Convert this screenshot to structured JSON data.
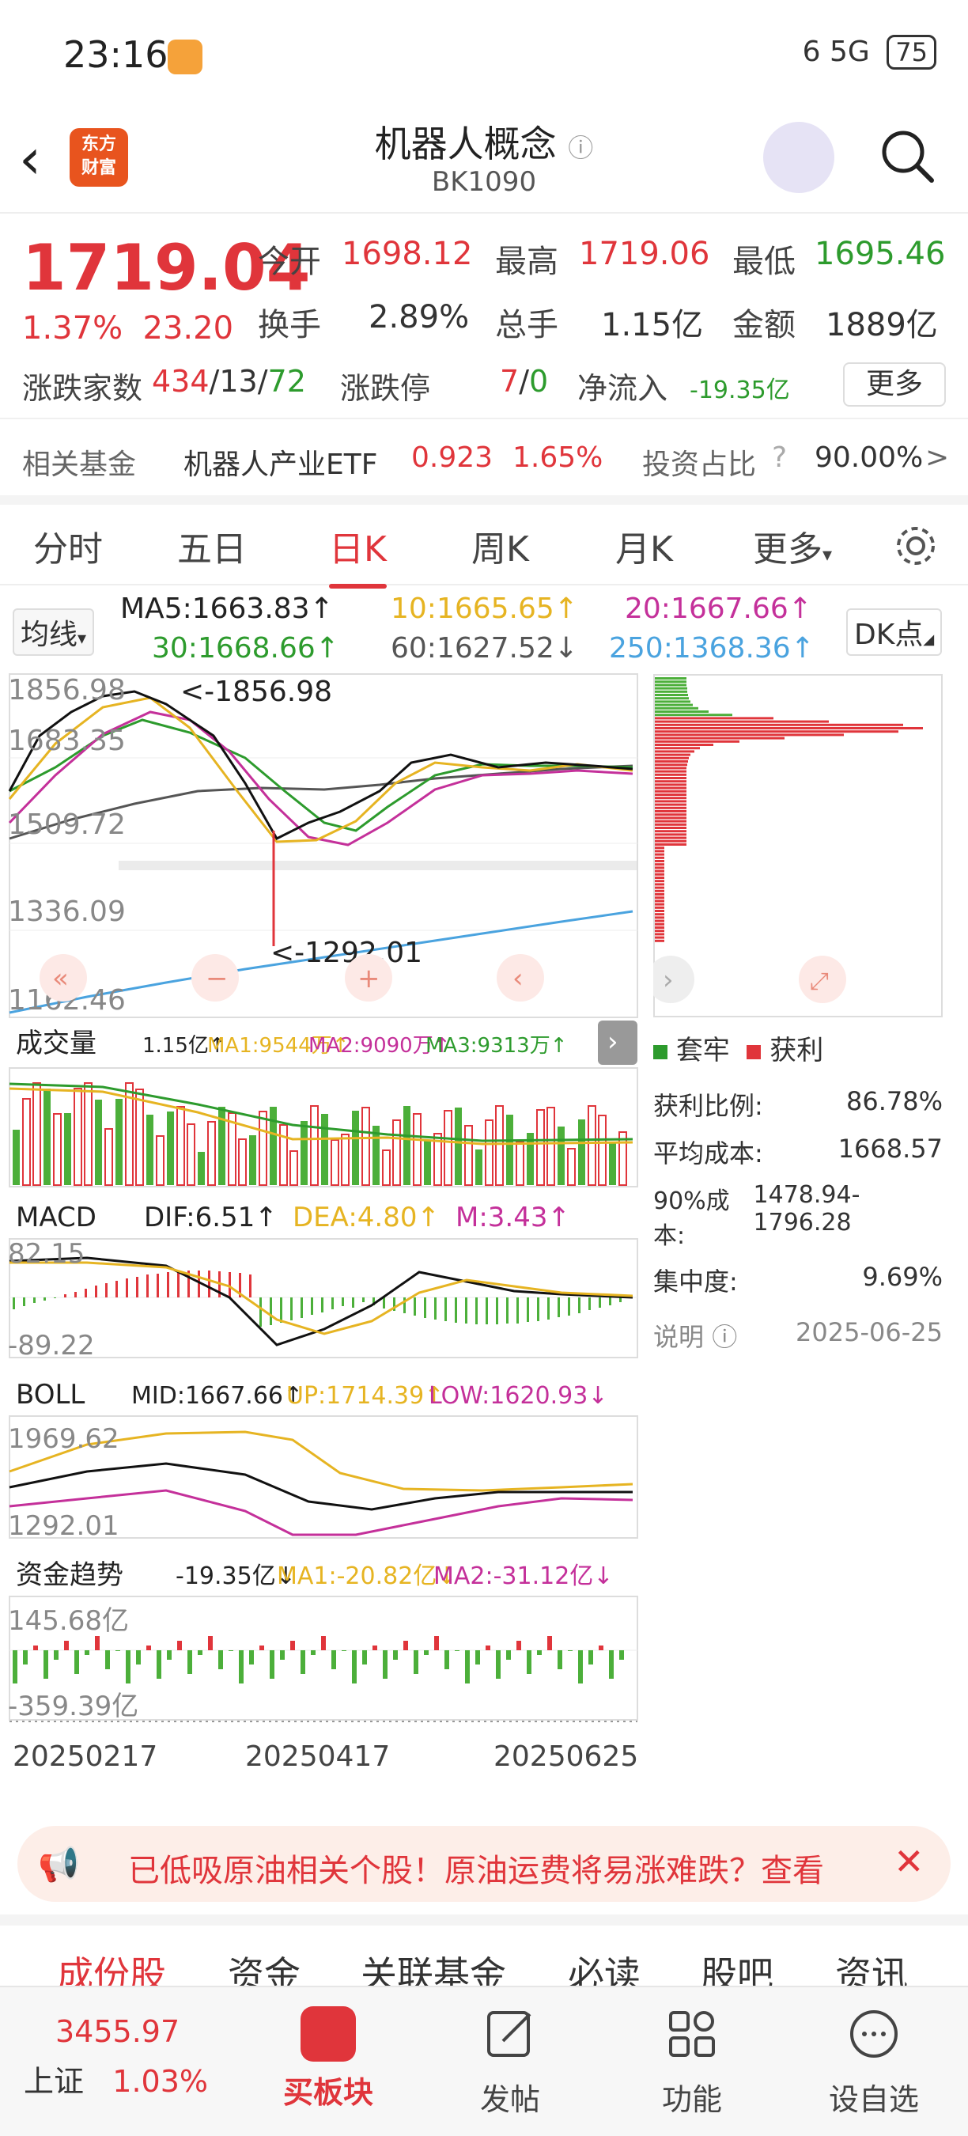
{
  "status": {
    "time": "23:16",
    "network": "6 5G",
    "battery": "75"
  },
  "header": {
    "logo_line1": "东方",
    "logo_line2": "财富",
    "title": "机器人概念",
    "code": "BK1090"
  },
  "quote": {
    "price": "1719.04",
    "change_pct": "1.37%",
    "change": "23.20",
    "open_label": "今开",
    "open": "1698.12",
    "high_label": "最高",
    "high": "1719.06",
    "low_label": "最低",
    "low": "1695.46",
    "turnover_label": "换手",
    "turnover": "2.89%",
    "volume_label": "总手",
    "volume": "1.15亿",
    "amount_label": "金额",
    "amount": "1889亿",
    "updown_label": "涨跌家数",
    "up": "434",
    "flat": "13",
    "down": "72",
    "limit_label": "涨跌停",
    "limit_up": "7",
    "limit_down": "0",
    "inflow_label": "净流入",
    "inflow": "-19.35亿",
    "more": "更多"
  },
  "fund": {
    "label": "相关基金",
    "name": "机器人产业ETF",
    "price": "0.923",
    "pct": "1.65%",
    "ratio_label": "投资占比",
    "ratio": "90.00%"
  },
  "tabs": [
    "分时",
    "五日",
    "日K",
    "周K",
    "月K",
    "更多"
  ],
  "ma": {
    "btn": "均线",
    "ma5": "MA5:1663.83↑",
    "ma10": "10:1665.65↑",
    "ma20": "20:1667.66↑",
    "ma30": "30:1668.66↑",
    "ma60": "60:1627.52↓",
    "ma250": "250:1368.36↑",
    "dk": "DK点"
  },
  "kline": {
    "y_labels": [
      "1856.98",
      "1683.35",
      "1509.72",
      "1336.09",
      "1162.46"
    ],
    "hi_note": "<-1856.98",
    "lo_note": "<-1292.01"
  },
  "volume": {
    "btn": "成交量",
    "v": "1.15亿↑",
    "ma1": "MA1:9544万↑",
    "ma2": "MA2:9090万↑",
    "ma3": "MA3:9313万↑"
  },
  "macd": {
    "btn": "MACD",
    "dif": "DIF:6.51↑",
    "dea": "DEA:4.80↑",
    "m": "M:3.43↑",
    "top": "82.15",
    "bottom": "-89.22"
  },
  "boll": {
    "btn": "BOLL",
    "mid": "MID:1667.66↑",
    "up": "UP:1714.39↑",
    "low": "LOW:1620.93↓",
    "top": "1969.62",
    "bottom": "1292.01"
  },
  "flow": {
    "btn": "资金趋势",
    "v": "-19.35亿↓",
    "ma1": "MA1:-20.82亿↓",
    "ma2": "MA2:-31.12亿↓",
    "top": "145.68亿",
    "bottom": "-359.39亿"
  },
  "dates": [
    "20250217",
    "20250417",
    "20250625"
  ],
  "chip": {
    "legend_trap": "套牢",
    "legend_profit": "获利",
    "profit_ratio_label": "获利比例:",
    "profit_ratio": "86.78%",
    "avg_cost_label": "平均成本:",
    "avg_cost": "1668.57",
    "cost90_label": "90%成本:",
    "cost90": "1478.94-1796.28",
    "conc_label": "集中度:",
    "conc": "9.69%",
    "note_label": "说明",
    "date": "2025-06-25"
  },
  "promo": {
    "text": "已低吸原油相关个股！原油运费将易涨难跌？查看"
  },
  "bottom_tabs": [
    "成份股",
    "资金",
    "关联基金",
    "必读",
    "股吧",
    "资讯"
  ],
  "nav": {
    "index_value": "3455.97",
    "index_name": "上证",
    "index_pct": "1.03%",
    "items": [
      "买板块",
      "发帖",
      "功能",
      "设自选"
    ]
  }
}
